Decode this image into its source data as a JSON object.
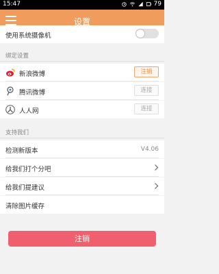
{
  "status_bar": {
    "time": "15:47",
    "battery": "79"
  },
  "toolbar": {
    "title": "设置"
  },
  "top_row": {
    "label": "使用系统摄像机",
    "toggle_on": false
  },
  "section_bind": {
    "heading": "绑定设置",
    "items": [
      {
        "icon": "weibo-icon",
        "label": "新浪微博",
        "button": "注销",
        "active": true
      },
      {
        "icon": "tencent-weibo-icon",
        "label": "腾讯微博",
        "button": "连接",
        "active": false
      },
      {
        "icon": "renren-icon",
        "label": "人人网",
        "button": "连接",
        "active": false
      }
    ]
  },
  "section_support": {
    "heading": "支持我们",
    "items": [
      {
        "label": "检测新版本",
        "value": "V4.06"
      },
      {
        "label": "给我们打个分吧"
      },
      {
        "label": "给我们提建议"
      },
      {
        "label": "清除图片缓存"
      }
    ]
  },
  "logout_button": {
    "label": "注销"
  },
  "colors": {
    "accent": "#ef9c5c",
    "logout": "#ef5f6e",
    "weibo": "#e6162d",
    "tencent": "#2d8dd8"
  }
}
